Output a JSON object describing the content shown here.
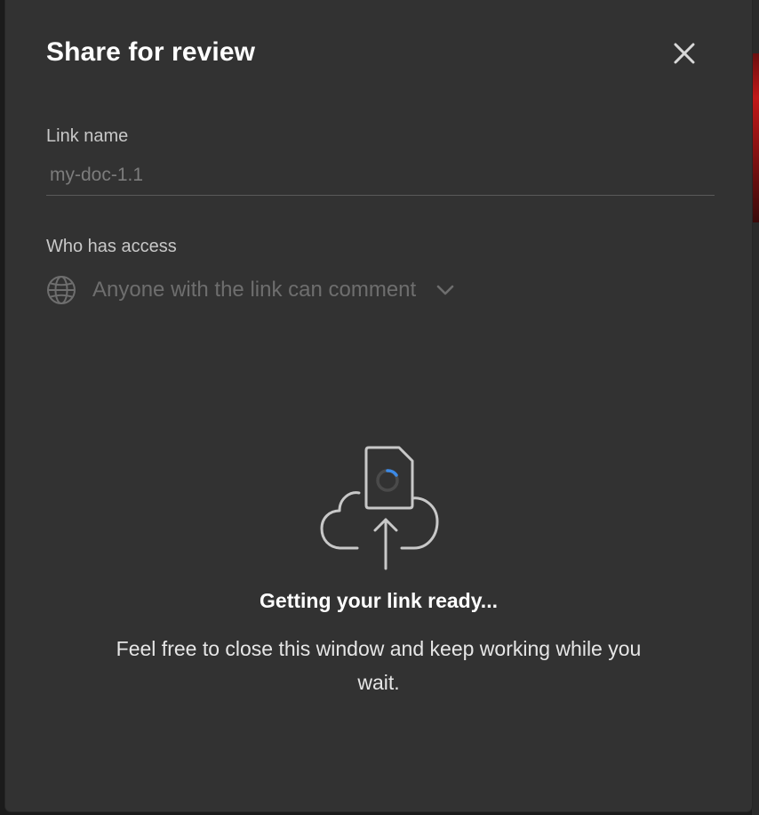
{
  "dialog": {
    "title": "Share for review",
    "close_icon": "close-icon"
  },
  "link_name": {
    "label": "Link name",
    "value": "my-doc-1.1"
  },
  "access": {
    "label": "Who has access",
    "icon": "globe-icon",
    "value": "Anyone with the link can comment",
    "dropdown_icon": "chevron-down-icon"
  },
  "status": {
    "illustration_icon": "cloud-upload-document-icon",
    "spinner_icon": "loading-spinner-icon",
    "title": "Getting your link ready...",
    "body": "Feel free to close this window and keep working while you wait."
  },
  "colors": {
    "dialog_background": "#323232",
    "spinner_accent": "#3c8ae6",
    "text_primary": "#ffffff",
    "text_muted": "#6e6e6e"
  }
}
